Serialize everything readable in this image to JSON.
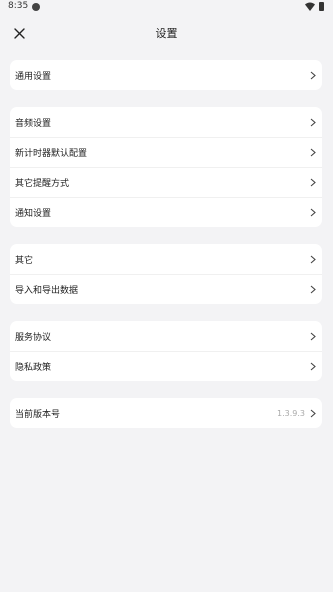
{
  "status_bar": {
    "time": "8:35"
  },
  "header": {
    "title": "设置"
  },
  "groups": [
    {
      "items": [
        {
          "label": "通用设置"
        }
      ]
    },
    {
      "items": [
        {
          "label": "音频设置"
        },
        {
          "label": "新计时器默认配置"
        },
        {
          "label": "其它提醒方式"
        },
        {
          "label": "通知设置"
        }
      ]
    },
    {
      "items": [
        {
          "label": "其它"
        },
        {
          "label": "导入和导出数据"
        }
      ]
    },
    {
      "items": [
        {
          "label": "服务协议"
        },
        {
          "label": "隐私政策"
        }
      ]
    },
    {
      "items": [
        {
          "label": "当前版本号",
          "value": "1.3.9.3"
        }
      ]
    }
  ]
}
